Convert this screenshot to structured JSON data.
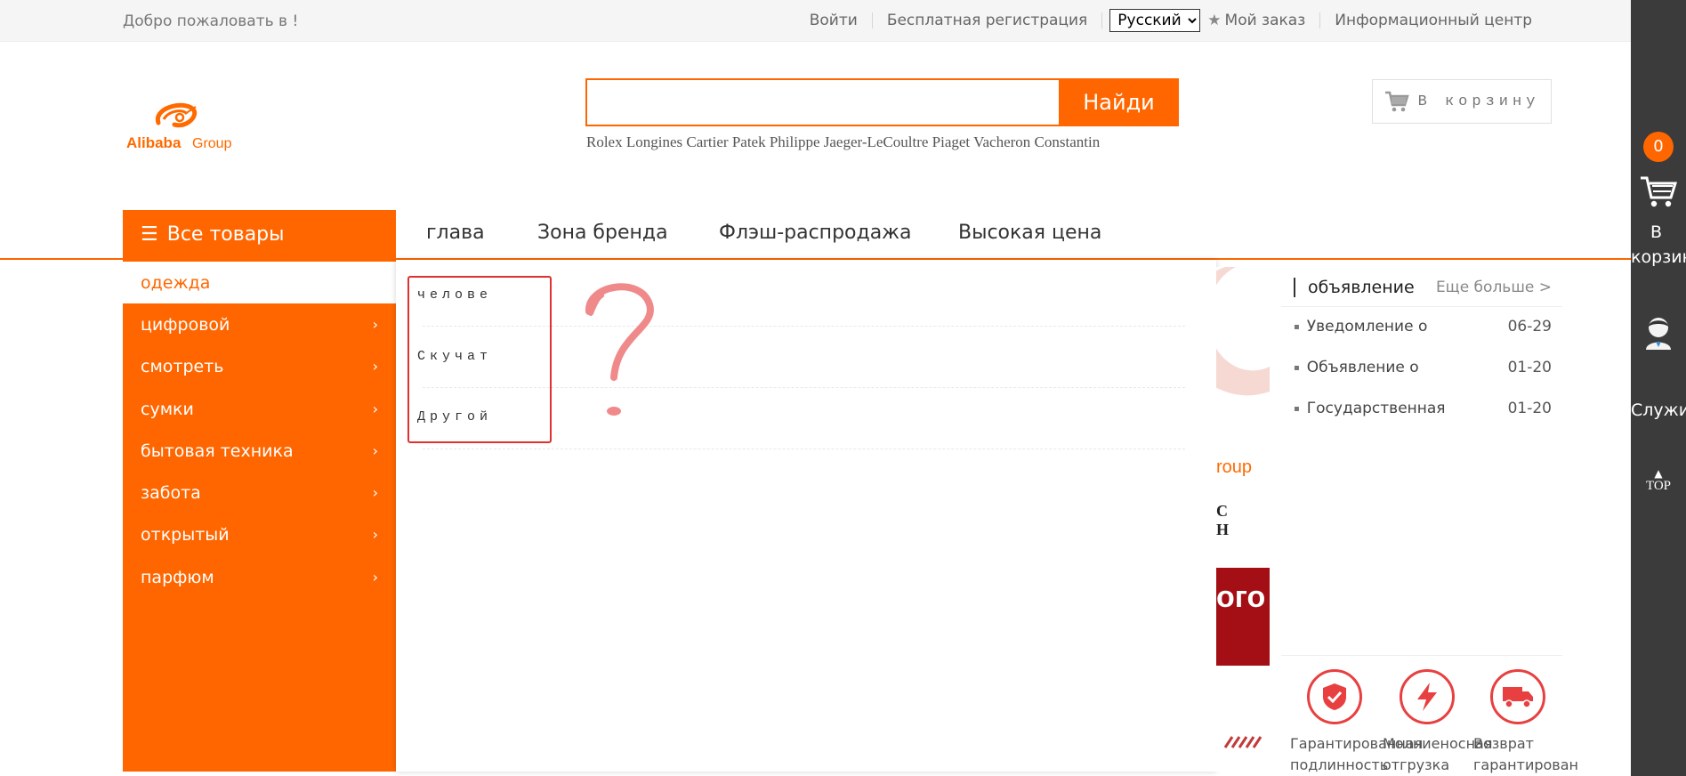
{
  "topbar": {
    "welcome": "Добро пожаловать в !",
    "login": "Войти",
    "register": "Бесплатная регистрация",
    "language": "Русский",
    "my_order": "Мой заказ",
    "info_center": "Информационный центр"
  },
  "header": {
    "logo_text": "Alibaba Group",
    "search_button": "Найди",
    "search_value": "",
    "hot_words": "Rolex Longines Cartier Patek Philippe Jaeger-LeCoultre Piaget Vacheron Constantin",
    "cart_button": "В корзину"
  },
  "nav": {
    "all_goods": "Все товары",
    "items": [
      "глава",
      "Зона бренда",
      "Флэш-распродажа",
      "Высокая цена"
    ]
  },
  "categories": [
    "одежда",
    "цифровой",
    "смотреть",
    "сумки",
    "бытовая техника",
    "забота",
    "открытый",
    "парфюм"
  ],
  "subcategories": [
    "челове",
    "Скучат",
    "Другой"
  ],
  "banner_fragments": [
    "roup",
    "С Н",
    "ого"
  ],
  "notice": {
    "title": "объявление",
    "more": "Еще больше >",
    "items": [
      {
        "text": "Уведомление о",
        "date": "06-29"
      },
      {
        "text": "Объявление о",
        "date": "01-20"
      },
      {
        "text": "Государственная",
        "date": "01-20"
      }
    ]
  },
  "services": [
    {
      "line1": "Гарантированная",
      "line2": "подлинность",
      "icon": "shield-check-icon"
    },
    {
      "line1": "Молниеносная",
      "line2": "отгрузка",
      "icon": "lightning-icon"
    },
    {
      "line1": "Возврат",
      "line2": "гарантирован",
      "icon": "truck-icon"
    }
  ],
  "sidebar": {
    "cart_count": "0",
    "cart_label_1": "В",
    "cart_label_2": "корзину",
    "service_label": "Служить",
    "top_label": "TOP"
  },
  "colors": {
    "accent": "#ff6600",
    "sidebar": "#3b3b3b",
    "highlight_box": "#e03030"
  }
}
